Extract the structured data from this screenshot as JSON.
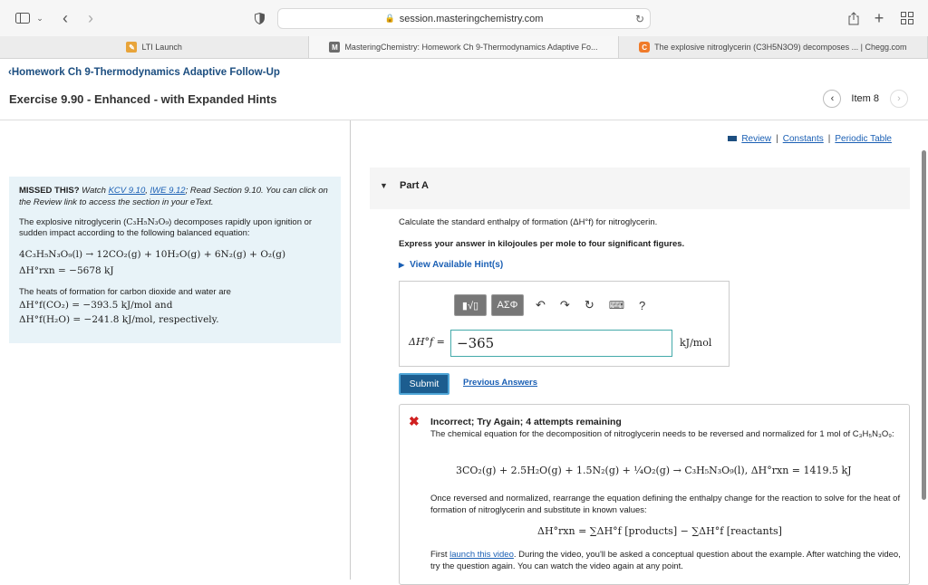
{
  "browser": {
    "url": "session.masteringchemistry.com",
    "tabs": [
      {
        "label": "LTI Launch",
        "favicon": "lti"
      },
      {
        "label": "MasteringChemistry: Homework Ch 9-Thermodynamics Adaptive Fo...",
        "favicon": "M"
      },
      {
        "label": "The explosive nitroglycerin (C3H5N3O9) decomposes ... | Chegg.com",
        "favicon": "C"
      }
    ]
  },
  "header": {
    "back_link": "Homework Ch 9-Thermodynamics Adaptive Follow-Up",
    "exercise_title": "Exercise 9.90 - Enhanced - with Expanded Hints",
    "item_label": "Item 8"
  },
  "hint_box": {
    "missed_lead": "MISSED THIS?",
    "missed_watch": "Watch",
    "link_kcv": "KCV 9.10",
    "link_iwe": "IWE 9.12",
    "missed_rest": "; Read Section 9.10. You can click on the Review link to access the section in your eText.",
    "para1_a": "The explosive nitroglycerin (",
    "formula_nitro": "C₃H₅N₃O₉",
    "para1_b": ") decomposes rapidly upon ignition or sudden impact according to the following balanced equation:",
    "reaction": "4C₃H₅N₃O₉(l) → 12CO₂(g) + 10H₂O(g) + 6N₂(g) + O₂(g)",
    "enthalpy": "ΔH°rxn = −5678 kJ",
    "para2": "The heats of formation for carbon dioxide and water are",
    "hf_co2": "ΔH°f(CO₂) = −393.5 kJ/mol and",
    "hf_h2o": "ΔH°f(H₂O) = −241.8 kJ/mol, respectively."
  },
  "right": {
    "links": {
      "review": "Review",
      "constants": "Constants",
      "periodic": "Periodic Table"
    },
    "part_label": "Part A",
    "question": "Calculate the standard enthalpy of formation (ΔH°f) for nitroglycerin.",
    "instruction": "Express your answer in kilojoules per mole to four significant figures.",
    "hints_label": "View Available Hint(s)",
    "answer_label": "ΔH°f =",
    "answer_value": "−365",
    "answer_unit": "kJ/mol",
    "submit_label": "Submit",
    "prev_label": "Previous Answers",
    "editor": {
      "template_btn": "▮√▯",
      "symbol_btn": "ΑΣΦ",
      "help": "?"
    }
  },
  "feedback": {
    "title": "Incorrect; Try Again; 4 attempts remaining",
    "text1": "The chemical equation for the decomposition of nitroglycerin needs to be reversed and normalized for 1 mol of C₃H₅N₃O₉:",
    "eq1": "3CO₂(g) + 2.5H₂O(g) + 1.5N₂(g) + ¼O₂(g) → C₃H₅N₃O₉(l),  ΔH°rxn = 1419.5 kJ",
    "text2": "Once reversed and normalized, rearrange the equation defining the enthalpy change for the reaction to solve for the heat of formation of nitroglycerin and substitute in known values:",
    "eq2": "ΔH°rxn = ∑ΔH°f [products] − ∑ΔH°f [reactants]",
    "text3_a": "First",
    "text3_link": "launch this video",
    "text3_b": ". During the video, you'll be asked a conceptual question about the example. After watching the video, try the question again. You can watch the video again at any point."
  }
}
